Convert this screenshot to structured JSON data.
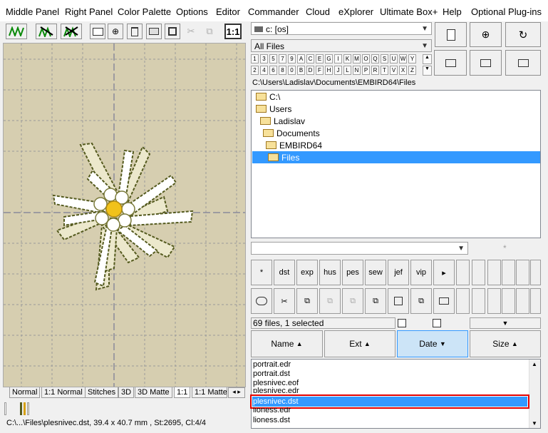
{
  "menu": [
    "Middle Panel",
    "Right Panel",
    "Color Palette",
    "Options",
    "Editor",
    "Commander",
    "Cloud",
    "eXplorer",
    "Ultimate Box+",
    "Help",
    "Optional Plug-ins"
  ],
  "toolbar_zoom_label": "1:1",
  "drive_select": "c: [os]",
  "filter_select": "All Files",
  "keys_row1": [
    "1",
    "3",
    "5",
    "7",
    "9",
    "A",
    "C",
    "E",
    "G",
    "I",
    "K",
    "M",
    "O",
    "Q",
    "S",
    "U",
    "W",
    "Y"
  ],
  "keys_row2": [
    "2",
    "4",
    "6",
    "8",
    "0",
    "B",
    "D",
    "F",
    "H",
    "J",
    "L",
    "N",
    "P",
    "R",
    "T",
    "V",
    "X",
    "Z"
  ],
  "path": "C:\\Users\\Ladislav\\Documents\\EMBIRD64\\Files",
  "tree": [
    "C:\\",
    "Users",
    "Ladislav",
    "Documents",
    "EMBIRD64",
    "Files"
  ],
  "asterisk": "*",
  "ext_buttons": [
    "*",
    "dst",
    "exp",
    "hus",
    "pes",
    "sew",
    "jef",
    "vip",
    "▸"
  ],
  "status": "69 files, 1 selected",
  "columns": [
    {
      "label": "Name",
      "arrow": "▲"
    },
    {
      "label": "Ext",
      "arrow": "▲"
    },
    {
      "label": "Date",
      "arrow": "▼"
    },
    {
      "label": "Size",
      "arrow": "▲"
    }
  ],
  "files": [
    "portrait.edr",
    "portrait.dst",
    "plesnivec.eof",
    "plesnivec.edr",
    "plesnivec.dst",
    "lioness.edr",
    "lioness.dst"
  ],
  "selected_file_index": 4,
  "tabs": [
    "Normal",
    "1:1 Normal",
    "Stitches",
    "3D",
    "3D Matte",
    "1:1",
    "1:1 Matte"
  ],
  "active_tab_index": 5,
  "status_bar": "C:\\...\\Files\\plesnivec.dst, 39.4 x 40.7 mm , St:2695, Cl:4/4",
  "colors": {
    "selection": "#3399ff",
    "canvas": "#d6ceb0",
    "highlight_box": "#e00000",
    "date_col": "#cce4f7"
  }
}
